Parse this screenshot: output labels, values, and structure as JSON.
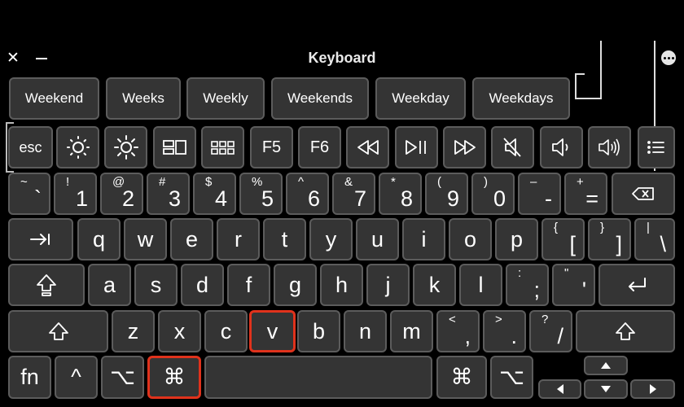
{
  "window": {
    "title": "Keyboard",
    "close_icon": "close-icon",
    "minimize_icon": "minimize-icon",
    "more_icon": "more-options-icon"
  },
  "suggestions": [
    "Weekend",
    "Weeks",
    "Weekly",
    "Weekends",
    "Weekday",
    "Weekdays"
  ],
  "function_row": {
    "esc": "esc",
    "f5": "F5",
    "f6": "F6",
    "icons": [
      "brightness-down-icon",
      "brightness-up-icon",
      "mission-control-icon",
      "launchpad-icon",
      "rewind-icon",
      "play-pause-icon",
      "fast-forward-icon",
      "mute-icon",
      "volume-down-icon",
      "volume-up-icon",
      "keyboard-options-icon"
    ]
  },
  "number_row": [
    {
      "top": "~",
      "bot": "`"
    },
    {
      "top": "!",
      "bot": "1"
    },
    {
      "top": "@",
      "bot": "2"
    },
    {
      "top": "#",
      "bot": "3"
    },
    {
      "top": "$",
      "bot": "4"
    },
    {
      "top": "%",
      "bot": "5"
    },
    {
      "top": "^",
      "bot": "6"
    },
    {
      "top": "&",
      "bot": "7"
    },
    {
      "top": "*",
      "bot": "8"
    },
    {
      "top": "(",
      "bot": "9"
    },
    {
      "top": ")",
      "bot": "0"
    },
    {
      "top": "–",
      "bot": "-"
    },
    {
      "top": "+",
      "bot": "="
    }
  ],
  "qwerty_row": [
    "q",
    "w",
    "e",
    "r",
    "t",
    "y",
    "u",
    "i",
    "o",
    "p"
  ],
  "qwerty_extra": [
    {
      "top": "{",
      "bot": "["
    },
    {
      "top": "}",
      "bot": "]"
    },
    {
      "top": "|",
      "bot": "\\"
    }
  ],
  "asdf_row": [
    "a",
    "s",
    "d",
    "f",
    "g",
    "h",
    "j",
    "k",
    "l"
  ],
  "asdf_extra": [
    {
      "top": ":",
      "bot": ";"
    },
    {
      "top": "\"",
      "bot": "'"
    }
  ],
  "zxcv_row": [
    "z",
    "x",
    "c",
    "v",
    "b",
    "n",
    "m"
  ],
  "zxcv_extra": [
    {
      "top": "<",
      "bot": ","
    },
    {
      "top": ">",
      "bot": "."
    },
    {
      "top": "?",
      "bot": "/"
    }
  ],
  "bottom_row": {
    "fn": "fn",
    "control": "^",
    "option": "⌥",
    "command": "⌘"
  },
  "highlight_color": "#e0321c"
}
